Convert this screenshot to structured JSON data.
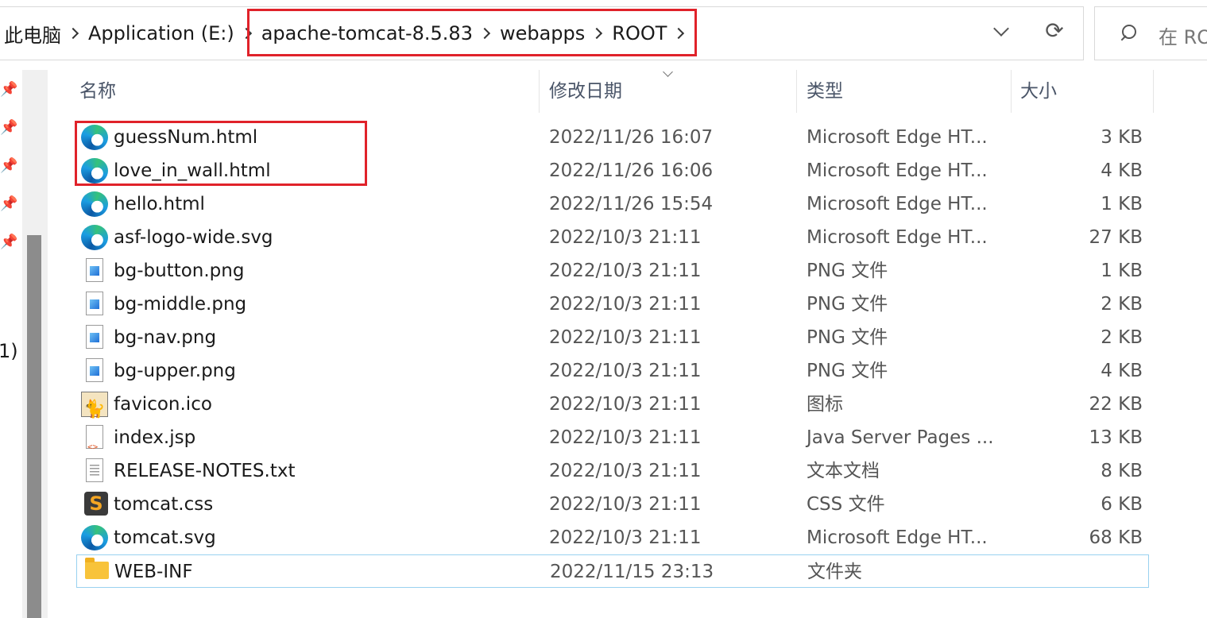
{
  "address": {
    "crumbs": [
      "此电脑",
      "Application (E:)",
      "apache-tomcat-8.5.83",
      "webapps",
      "ROOT"
    ]
  },
  "search": {
    "placeholder": "在 RO"
  },
  "nav": {
    "partial_label": "1)"
  },
  "columns": {
    "name": "名称",
    "date": "修改日期",
    "type": "类型",
    "size": "大小"
  },
  "files": [
    {
      "name": "guessNum.html",
      "date": "2022/11/26 16:07",
      "type": "Microsoft Edge HT...",
      "size": "3 KB",
      "icon": "edge-html-icon"
    },
    {
      "name": "love_in_wall.html",
      "date": "2022/11/26 16:06",
      "type": "Microsoft Edge HT...",
      "size": "4 KB",
      "icon": "edge-html-icon"
    },
    {
      "name": "hello.html",
      "date": "2022/11/26 15:54",
      "type": "Microsoft Edge HT...",
      "size": "1 KB",
      "icon": "edge-html-icon"
    },
    {
      "name": "asf-logo-wide.svg",
      "date": "2022/10/3 21:11",
      "type": "Microsoft Edge HT...",
      "size": "27 KB",
      "icon": "edge-html-icon"
    },
    {
      "name": "bg-button.png",
      "date": "2022/10/3 21:11",
      "type": "PNG 文件",
      "size": "1 KB",
      "icon": "png-file-icon"
    },
    {
      "name": "bg-middle.png",
      "date": "2022/10/3 21:11",
      "type": "PNG 文件",
      "size": "2 KB",
      "icon": "png-file-icon"
    },
    {
      "name": "bg-nav.png",
      "date": "2022/10/3 21:11",
      "type": "PNG 文件",
      "size": "2 KB",
      "icon": "png-file-icon"
    },
    {
      "name": "bg-upper.png",
      "date": "2022/10/3 21:11",
      "type": "PNG 文件",
      "size": "4 KB",
      "icon": "png-file-icon"
    },
    {
      "name": "favicon.ico",
      "date": "2022/10/3 21:11",
      "type": "图标",
      "size": "22 KB",
      "icon": "tomcat-favicon-icon"
    },
    {
      "name": "index.jsp",
      "date": "2022/10/3 21:11",
      "type": "Java Server Pages ...",
      "size": "13 KB",
      "icon": "jsp-file-icon"
    },
    {
      "name": "RELEASE-NOTES.txt",
      "date": "2022/10/3 21:11",
      "type": "文本文档",
      "size": "8 KB",
      "icon": "text-file-icon"
    },
    {
      "name": "tomcat.css",
      "date": "2022/10/3 21:11",
      "type": "CSS 文件",
      "size": "6 KB",
      "icon": "sublime-css-icon"
    },
    {
      "name": "tomcat.svg",
      "date": "2022/10/3 21:11",
      "type": "Microsoft Edge HT...",
      "size": "68 KB",
      "icon": "edge-html-icon"
    },
    {
      "name": "WEB-INF",
      "date": "2022/11/15 23:13",
      "type": "文件夹",
      "size": "",
      "icon": "folder-icon"
    }
  ],
  "colors": {
    "highlight": "#e0222a",
    "selection_border": "#99d1f0"
  }
}
